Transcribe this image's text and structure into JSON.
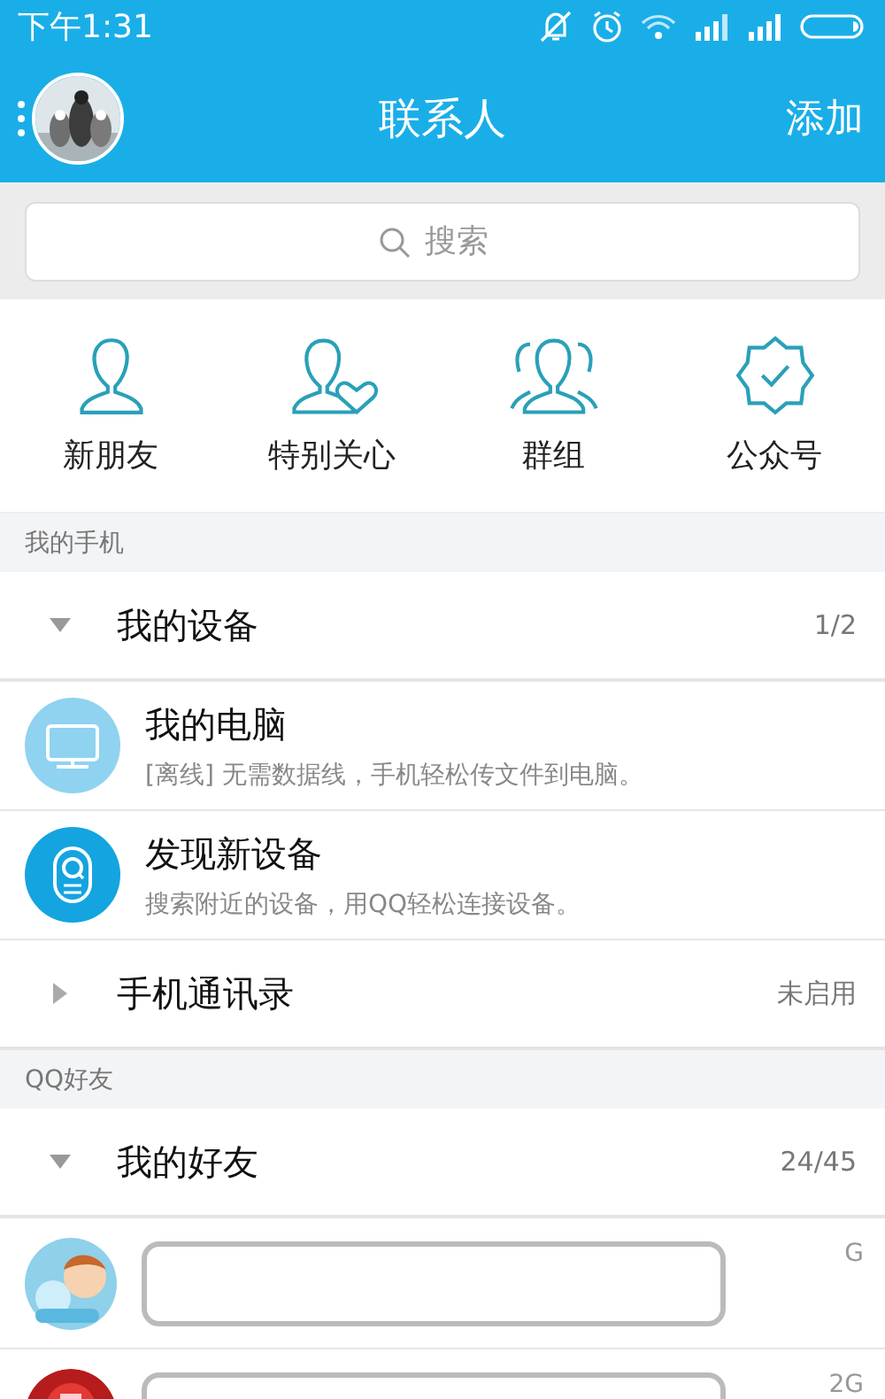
{
  "status_bar": {
    "time": "下午1:31"
  },
  "header": {
    "title": "联系人",
    "action": "添加"
  },
  "search": {
    "placeholder": "搜索"
  },
  "quick_actions": [
    {
      "kind": "person",
      "label": "新朋友"
    },
    {
      "kind": "heart",
      "label": "特别关心"
    },
    {
      "kind": "group",
      "label": "群组"
    },
    {
      "kind": "badge",
      "label": "公众号"
    }
  ],
  "sections": [
    {
      "title": "我的手机",
      "items": [
        {
          "kind": "group",
          "name": "我的设备",
          "count": "1/2",
          "expanded": true
        },
        {
          "kind": "computer",
          "name": "我的电脑",
          "description": "[离线] 无需数据线，手机轻松传文件到电脑。"
        },
        {
          "kind": "finder",
          "name": "发现新设备",
          "description": "搜索附近的设备，用QQ轻松连接设备。"
        },
        {
          "kind": "group",
          "name": "手机通讯录",
          "count": "未启用",
          "expanded": false
        }
      ]
    },
    {
      "title": "QQ好友",
      "items": [
        {
          "kind": "group",
          "name": "我的好友",
          "count": "24/45",
          "expanded": true
        },
        {
          "kind": "friend",
          "network": "G"
        },
        {
          "kind": "friend",
          "network": "2G"
        }
      ]
    }
  ]
}
